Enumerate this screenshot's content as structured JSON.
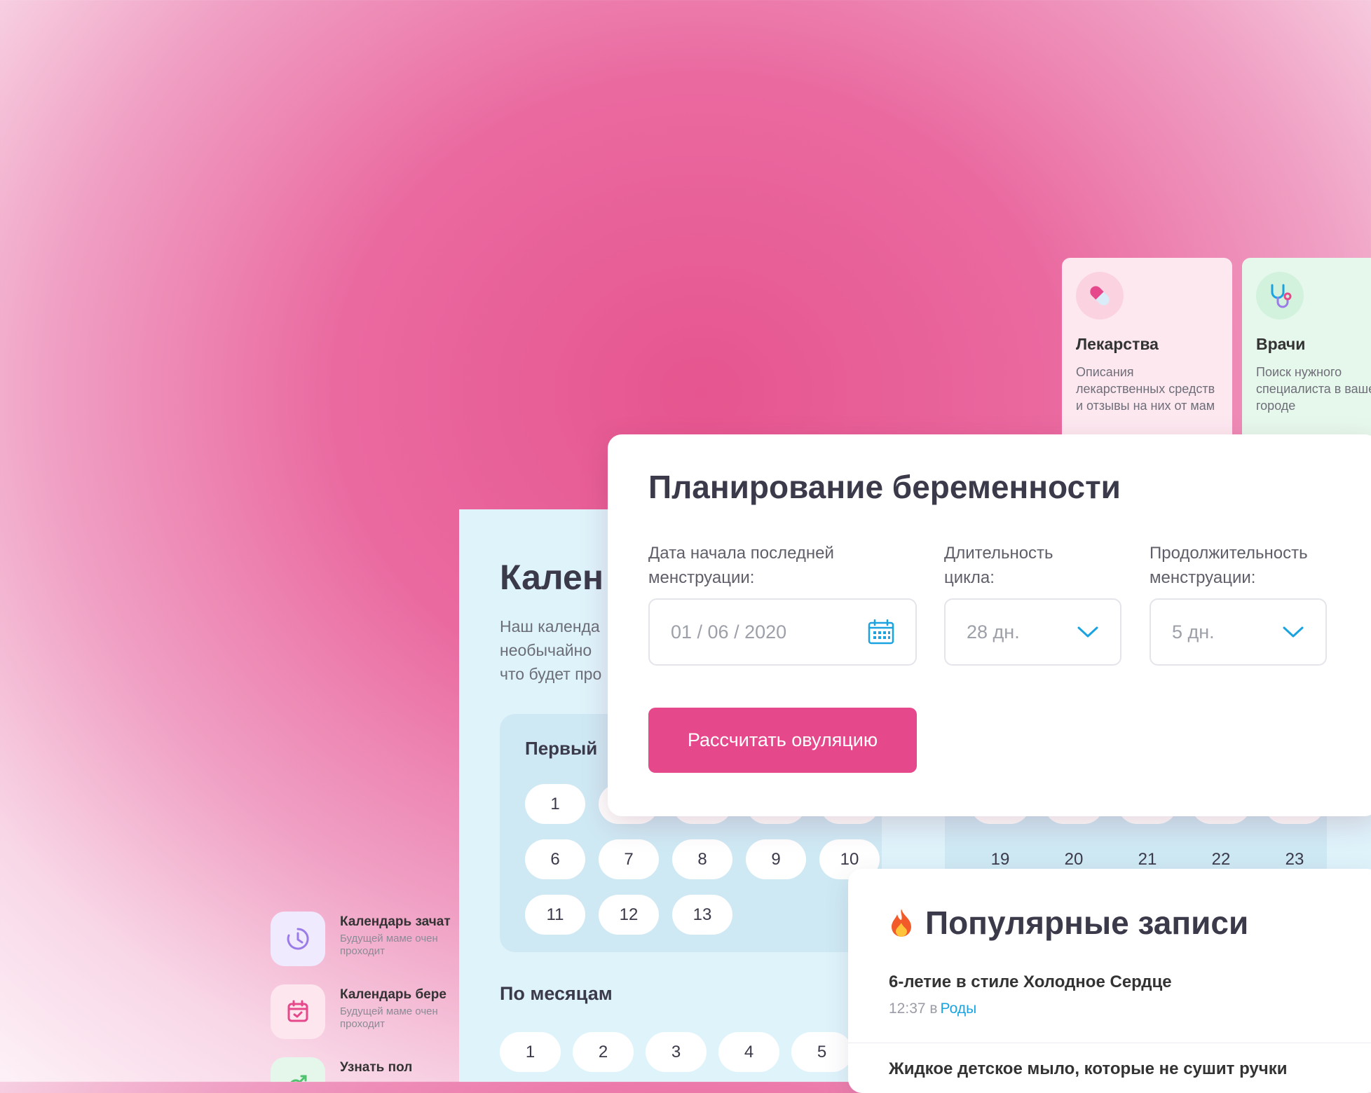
{
  "services": [
    {
      "title": "Лекарства",
      "desc": "Описания лекарственных средств и отзывы на них от мам",
      "icon": "pill-icon",
      "bg": "#fde8f0",
      "icon_bg": "#fbd3e0"
    },
    {
      "title": "Врачи",
      "desc": "Поиск нужного специалиста в вашем городе",
      "icon": "stethoscope-icon",
      "bg": "#e6f8ec",
      "icon_bg": "#d2f2dd"
    }
  ],
  "calendar": {
    "title": "Кален",
    "desc_lines": [
      "Наш календа",
      "необычайно",
      "что будет про"
    ],
    "first_day_label": "Первый",
    "days_left": [
      [
        "1",
        "",
        "",
        "",
        ""
      ],
      [
        "6",
        "7",
        "8",
        "9",
        "10"
      ],
      [
        "11",
        "12",
        "13"
      ]
    ],
    "days_right": [
      [
        "",
        "",
        "",
        "",
        ""
      ],
      [
        "19",
        "20",
        "21",
        "22",
        "23"
      ]
    ],
    "months_label": "По месяцам",
    "months": [
      "1",
      "2",
      "3",
      "4",
      "5"
    ]
  },
  "tools": [
    {
      "title": "Календарь зачат",
      "sub": "Будущей маме очен проходит",
      "icon": "clock-icon",
      "bg": "#efeafd",
      "color": "#9b7be8"
    },
    {
      "title": "Календарь бере",
      "sub": "Будущей маме очен проходит",
      "icon": "calendar-check-icon",
      "bg": "#fde6ee",
      "color": "#e5498c"
    },
    {
      "title": "Узнать пол",
      "sub": "",
      "icon": "gender-icon",
      "bg": "#e4f7ea",
      "color": "#4fc26e"
    }
  ],
  "planning": {
    "title": "Планирование беременности",
    "fields": [
      {
        "label": "Дата начала последней менструации:",
        "value": "01 / 06 / 2020",
        "icon": "calendar-icon"
      },
      {
        "label": "Длительность цикла:",
        "value": "28 дн.",
        "icon": "chevron-down-icon"
      },
      {
        "label": "Продолжительность менструации:",
        "value": "5 дн.",
        "icon": "chevron-down-icon"
      }
    ],
    "button": "Рассчитать овуляцию"
  },
  "popular": {
    "title": "Популярные записи",
    "posts": [
      {
        "title": "6-летие в стиле Холодное Сердце",
        "time": "12:37 в",
        "category": "Роды"
      },
      {
        "title": "Жидкое детское мыло, которые не сушит ручки",
        "time": "",
        "category": ""
      }
    ]
  },
  "colors": {
    "accent": "#e5498c",
    "link": "#1aa3e0",
    "icon_blue": "#1aa3e0"
  }
}
